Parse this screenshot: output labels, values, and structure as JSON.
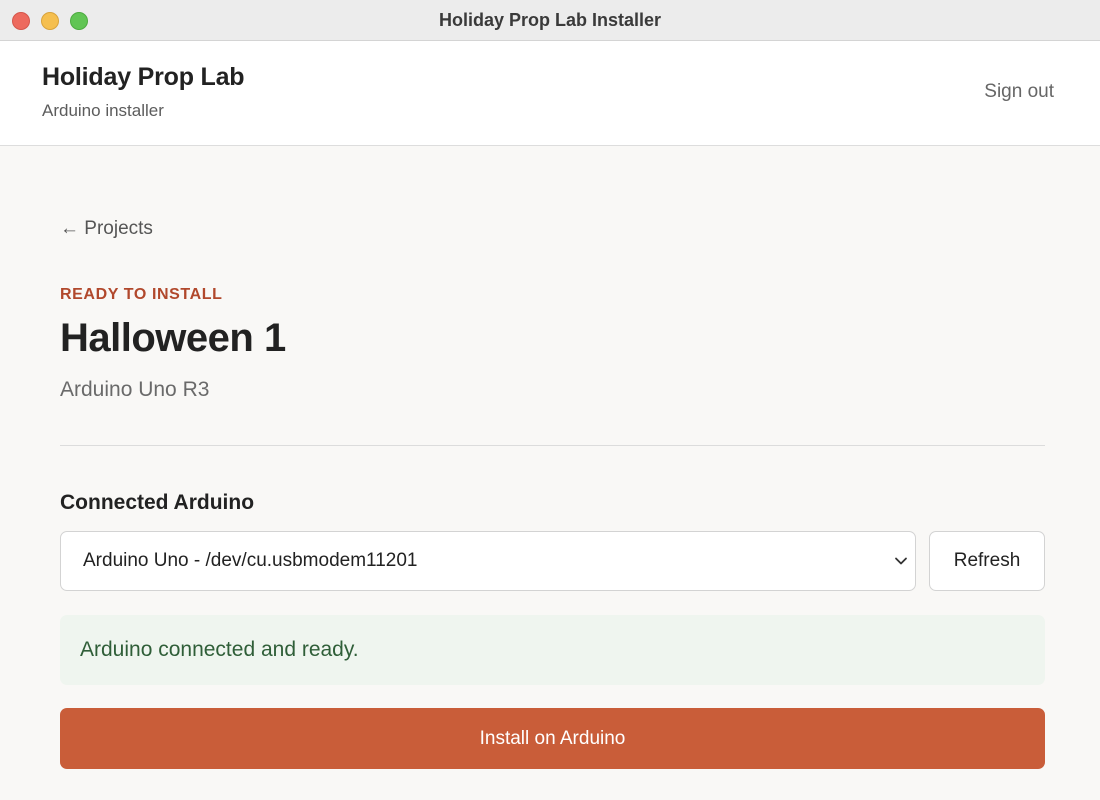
{
  "window": {
    "title": "Holiday Prop Lab Installer",
    "controls": [
      "close",
      "minimize",
      "maximize"
    ]
  },
  "header": {
    "brand_title": "Holiday Prop Lab",
    "brand_subtitle": "Arduino installer",
    "sign_out_label": "Sign out"
  },
  "main": {
    "back_link": "← Projects",
    "status_eyebrow": "READY TO INSTALL",
    "project_title": "Halloween 1",
    "board_name": "Arduino Uno R3",
    "connected_section_label": "Connected Arduino",
    "port_select": {
      "selected_value": "Arduino Uno - /dev/cu.usbmodem11201",
      "icon": "chevron-down-icon"
    },
    "refresh_label": "Refresh",
    "status_message": "Arduino connected and ready.",
    "install_label": "Install on Arduino"
  },
  "colors": {
    "accent": "#c95d39",
    "eyebrow": "#b1482c",
    "success_bg": "#eff5ef",
    "success_text": "#2f5e38"
  }
}
